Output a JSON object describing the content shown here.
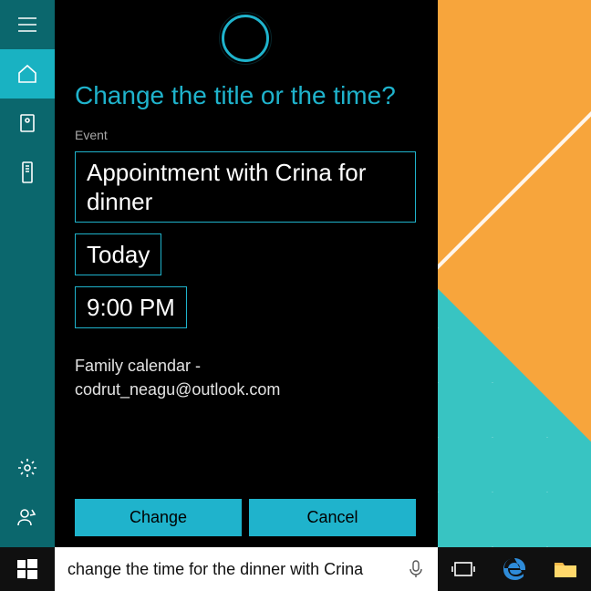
{
  "cortana": {
    "prompt": "Change the title or the time?",
    "event_label": "Event",
    "title_value": "Appointment with Crina for dinner",
    "date_value": "Today",
    "time_value": "9:00 PM",
    "calendar_line1": "Family calendar -",
    "calendar_line2": "codrut_neagu@outlook.com",
    "change_label": "Change",
    "cancel_label": "Cancel"
  },
  "taskbar": {
    "search_value": "change the time for the dinner with Crina"
  },
  "colors": {
    "accent": "#1fb3cc",
    "sidebar": "#0b676d"
  }
}
